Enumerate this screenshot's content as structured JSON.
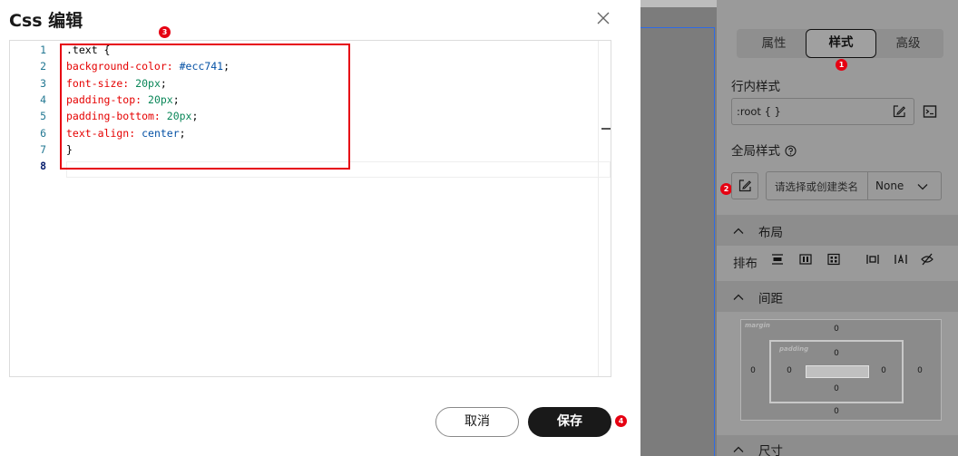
{
  "dialog": {
    "title": "Css 编辑",
    "cancel_label": "取消",
    "save_label": "保存",
    "close_icon": "close-icon"
  },
  "editor": {
    "line_numbers": [
      "1",
      "2",
      "3",
      "4",
      "5",
      "6",
      "7",
      "8"
    ],
    "lines": [
      [
        {
          "t": ".text {",
          "c": "tk-punc"
        }
      ],
      [
        {
          "t": "background-color: ",
          "c": "tk-prop"
        },
        {
          "t": "#ecc741",
          "c": "tk-hex"
        },
        {
          "t": ";",
          "c": "tk-punc"
        }
      ],
      [
        {
          "t": "font-size: ",
          "c": "tk-prop"
        },
        {
          "t": "20px",
          "c": "tk-num"
        },
        {
          "t": ";",
          "c": "tk-punc"
        }
      ],
      [
        {
          "t": "padding-top: ",
          "c": "tk-prop"
        },
        {
          "t": "20px",
          "c": "tk-num"
        },
        {
          "t": ";",
          "c": "tk-punc"
        }
      ],
      [
        {
          "t": "padding-bottom: ",
          "c": "tk-prop"
        },
        {
          "t": "20px",
          "c": "tk-num"
        },
        {
          "t": ";",
          "c": "tk-punc"
        }
      ],
      [
        {
          "t": "text-align: ",
          "c": "tk-prop"
        },
        {
          "t": "center",
          "c": "tk-kw"
        },
        {
          "t": ";",
          "c": "tk-punc"
        }
      ],
      [
        {
          "t": "}",
          "c": "tk-punc"
        }
      ],
      []
    ],
    "active_line": 8
  },
  "badges": {
    "b1": "1",
    "b2": "2",
    "b3": "3",
    "b4": "4"
  },
  "panel": {
    "tabs": [
      {
        "label": "属性",
        "active": false
      },
      {
        "label": "样式",
        "active": true
      },
      {
        "label": "高级",
        "active": false
      }
    ],
    "inline_style_label": "行内样式",
    "inline_style_value": ":root { }",
    "global_style_label": "全局样式",
    "class_placeholder": "请选择或创建类名",
    "class_value": "None",
    "layout_section": "布局",
    "arrange_label": "排布",
    "spacing_section": "间距",
    "size_section": "尺寸",
    "spacing": {
      "margin_label": "margin",
      "padding_label": "padding",
      "margin_top": "0",
      "margin_left": "0",
      "margin_right": "0",
      "margin_bottom": "0",
      "padding_top": "0",
      "padding_left": "0",
      "padding_right": "0",
      "padding_bottom": "0"
    }
  },
  "colors": {
    "accent_badge": "#e60012",
    "highlight_box": "#e60012",
    "save_button_bg": "#191919",
    "canvas_selection": "#2e6be6"
  }
}
